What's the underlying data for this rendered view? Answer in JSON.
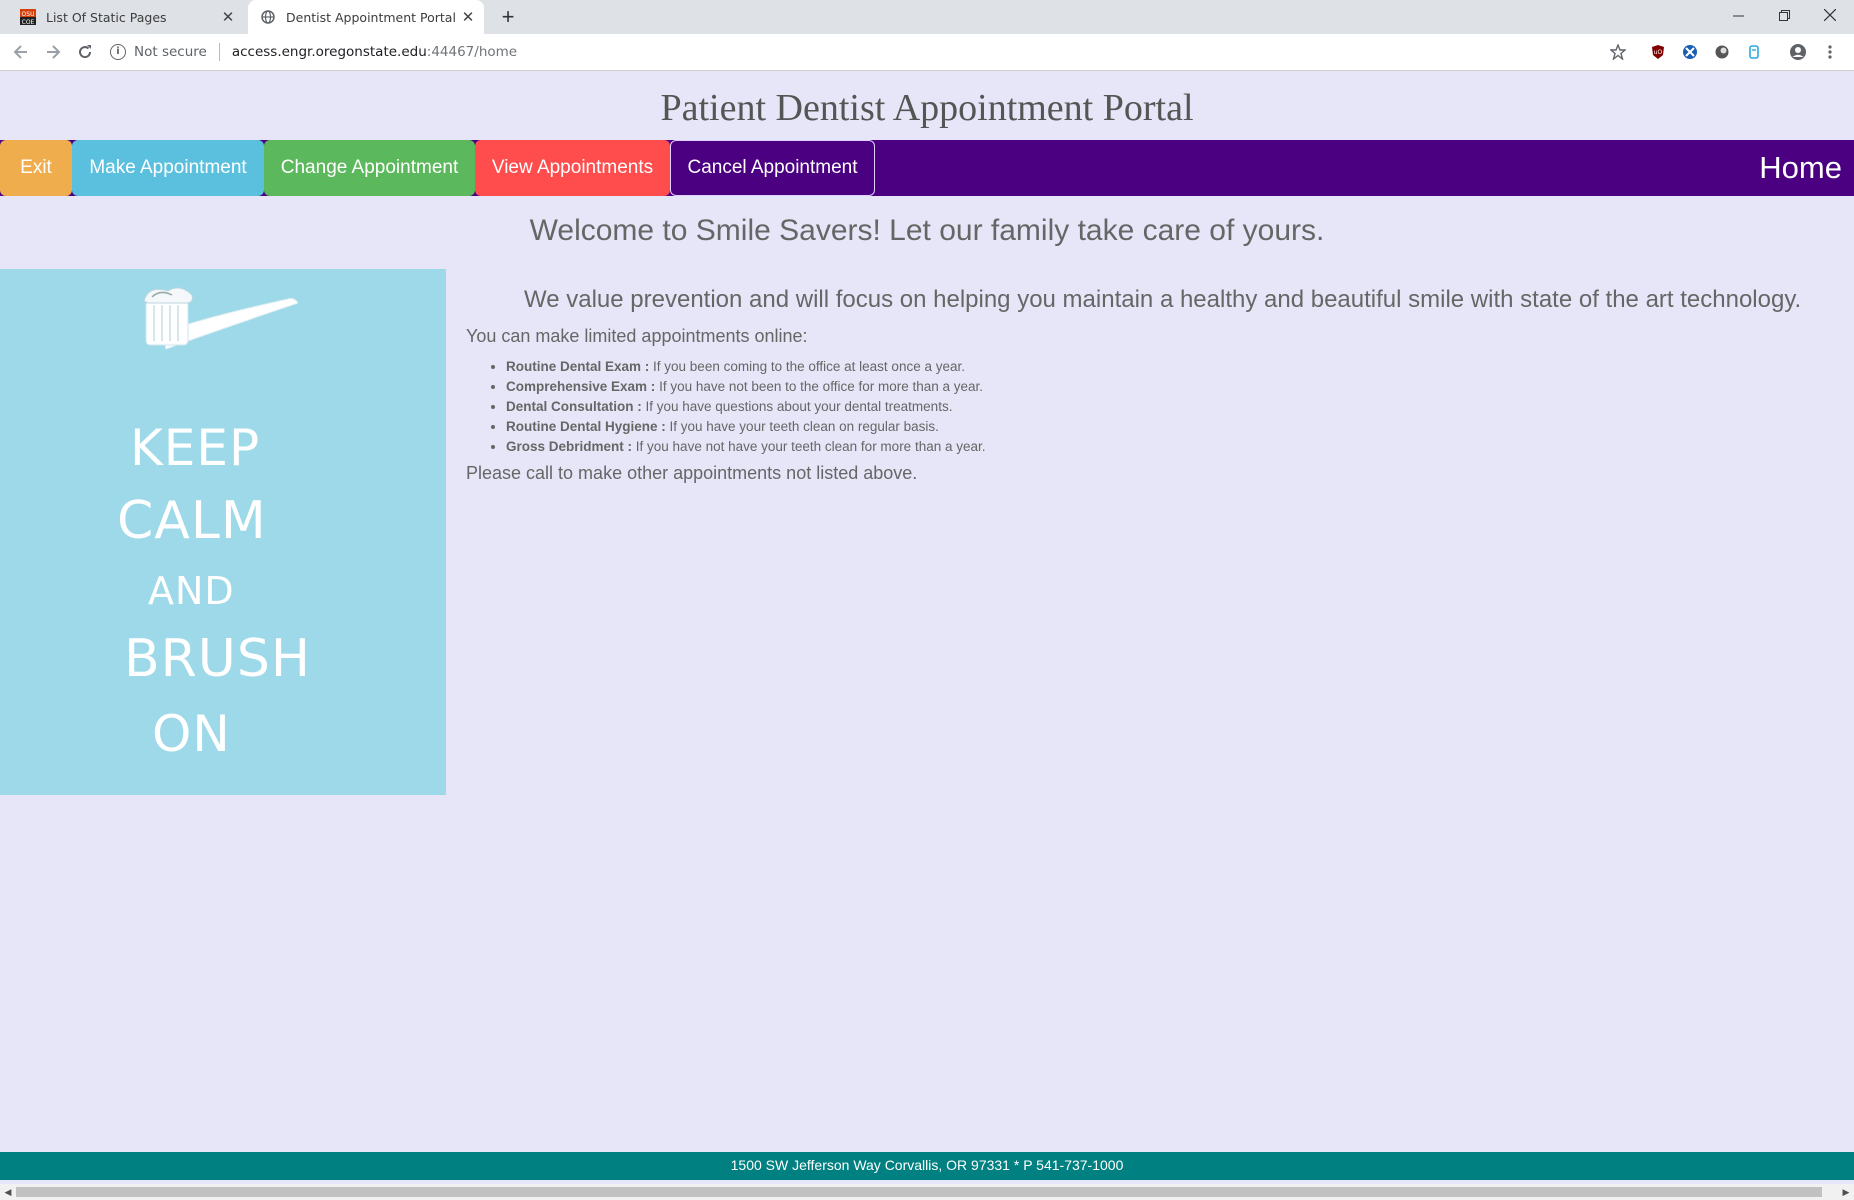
{
  "browser": {
    "tabs": [
      {
        "label": "List Of Static Pages",
        "icon": "osu-favicon-icon"
      },
      {
        "label": "Dentist Appointment Portal",
        "icon": "globe-icon"
      }
    ],
    "address": {
      "security": "Not secure",
      "host": "access.engr.oregonstate.edu",
      "path": ":44467/home"
    }
  },
  "page": {
    "title": "Patient Dentist Appointment Portal",
    "nav": {
      "exit": "Exit",
      "make": "Make Appointment",
      "change": "Change Appointment",
      "view": "View Appointments",
      "cancel": "Cancel Appointment",
      "current": "Home"
    },
    "welcome": "Welcome to Smile Savers! Let our family take care of yours.",
    "poster": {
      "line1": "KEEP",
      "line2": "CALM",
      "line3": "AND",
      "line4": "BRUSH",
      "line5": "ON"
    },
    "value_statement": "We value prevention and will focus on helping you maintain a healthy and beautiful smile with state of the art technology.",
    "intro": "You can make limited appointments online:",
    "services": [
      {
        "name": "Routine Dental Exam :",
        "desc": " If you been coming to the office at least once a year."
      },
      {
        "name": "Comprehensive Exam :",
        "desc": " If you have not been to the office for more than a year."
      },
      {
        "name": "Dental Consultation :",
        "desc": " If you have questions about your dental treatments."
      },
      {
        "name": "Routine Dental Hygiene :",
        "desc": " If you have your teeth clean on regular basis."
      },
      {
        "name": "Gross Debridment :",
        "desc": " If you have not have your teeth clean for more than a year."
      }
    ],
    "outro": "Please call to make other appointments not listed above.",
    "footer": "1500 SW Jefferson Way Corvallis, OR 97331 * P 541-737-1000"
  },
  "colors": {
    "page_bg": "#e6e6f8",
    "navbar": "#4b0082",
    "exit": "#f0ad4e",
    "make": "#5bc0de",
    "change": "#5cb85c",
    "view": "#ff4c4c",
    "poster_bg": "#9dd9e8",
    "footer": "#008080"
  }
}
